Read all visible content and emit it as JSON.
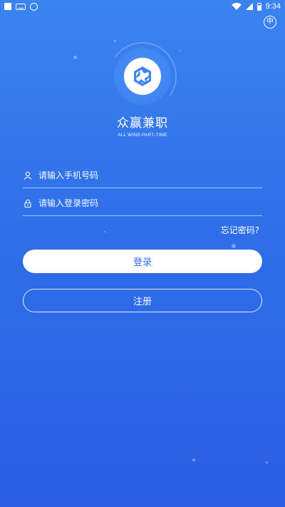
{
  "status_bar": {
    "time": "9:34"
  },
  "language_toggle": "中",
  "brand": {
    "title": "众赢兼职",
    "subtitle": "ALL WINS PART-TIME"
  },
  "login_form": {
    "phone_placeholder": "请输入手机号码",
    "password_placeholder": "请输入登录密码",
    "forgot_password": "忘记密码?",
    "login_button": "登录",
    "register_button": "注册"
  },
  "icons": {
    "user": "user-icon",
    "lock": "lock-icon",
    "logo": "shutter-logo-icon"
  },
  "colors": {
    "background_top": "#3b83f1",
    "background_bottom": "#2b5ee3",
    "button_text": "#2f6fe8",
    "logo_blue": "#3f84f2"
  }
}
